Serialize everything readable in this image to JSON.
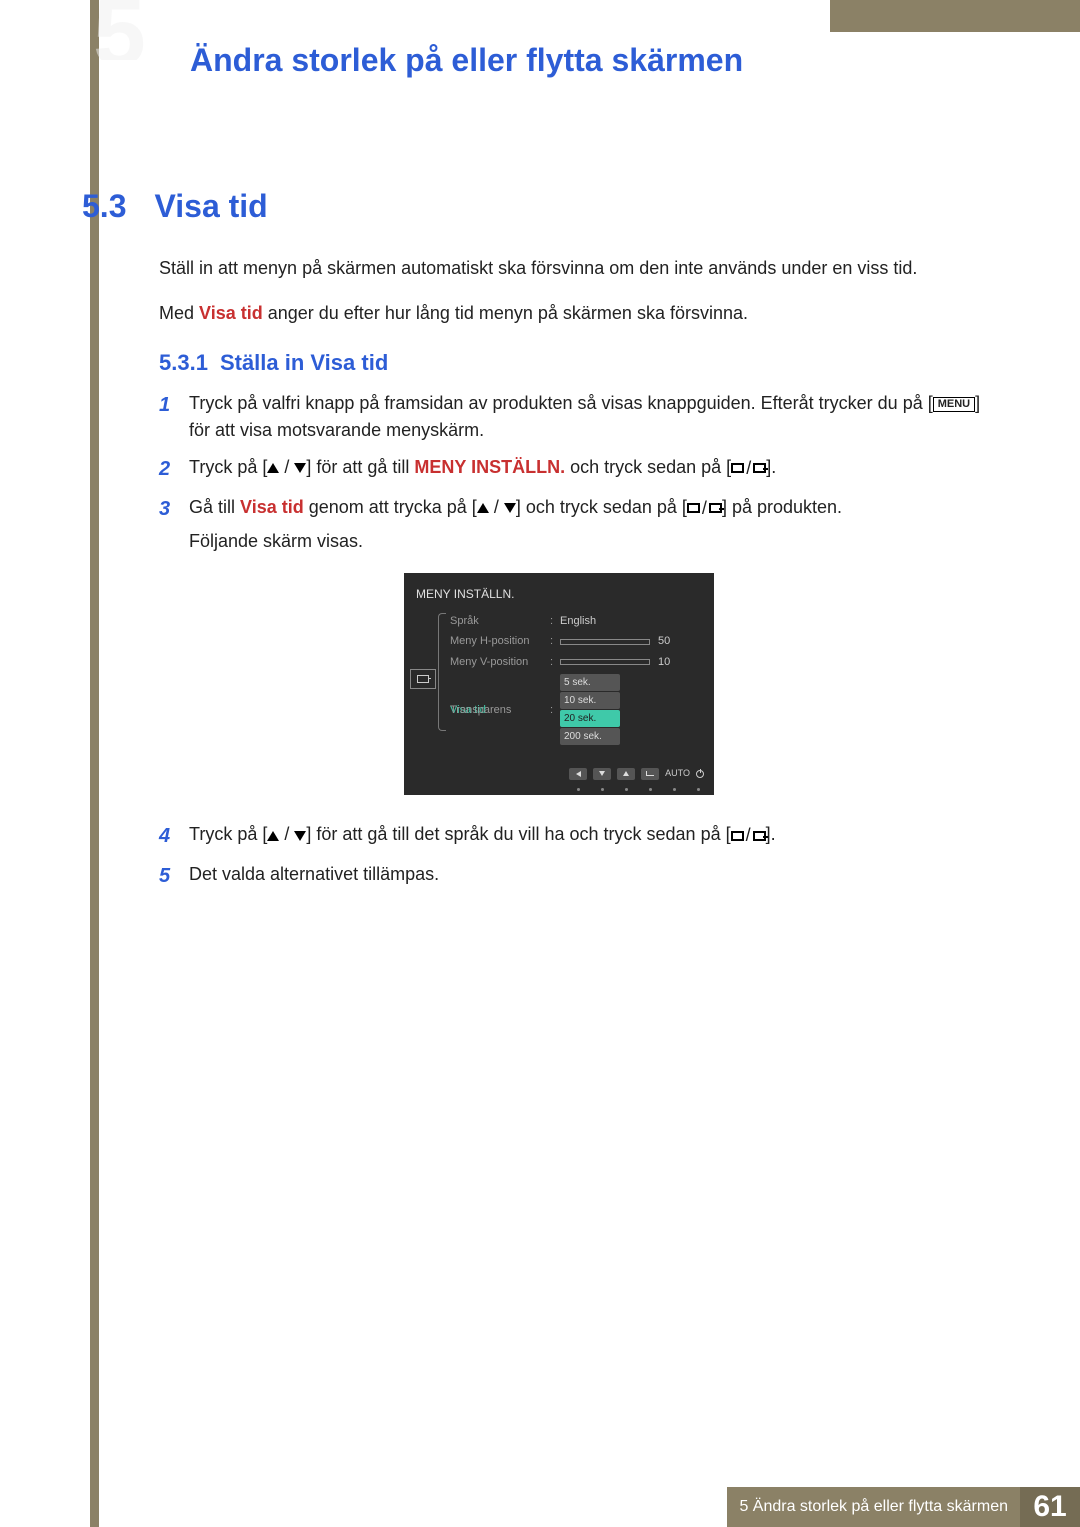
{
  "chapter_bg_number": "5",
  "chapter_title": "Ändra storlek på eller flytta skärmen",
  "section": {
    "number": "5.3",
    "title": "Visa tid"
  },
  "intro": {
    "p1": "Ställ in att menyn på skärmen automatiskt ska försvinna om den inte används under en viss tid.",
    "p2_pre": "Med ",
    "p2_term": "Visa tid",
    "p2_post": " anger du efter hur lång tid menyn på skärmen ska försvinna."
  },
  "subsection": {
    "number": "5.3.1",
    "title": "Ställa in Visa tid"
  },
  "steps": {
    "s1_num": "1",
    "s1_a": "Tryck på valfri knapp på framsidan av produkten så visas knappguiden. Efteråt trycker du på [",
    "s1_menu": "MENU",
    "s1_b": "] för att visa motsvarande menyskärm.",
    "s2_num": "2",
    "s2_a": "Tryck på [",
    "s2_b": "] för att gå till ",
    "s2_term": "MENY INSTÄLLN.",
    "s2_c": " och tryck sedan på [",
    "s2_d": "].",
    "s3_num": "3",
    "s3_a": "Gå till ",
    "s3_term": "Visa tid",
    "s3_b": " genom att trycka på [",
    "s3_c": "] och tryck sedan på [",
    "s3_d": "] på produkten.",
    "s3_e": "Följande skärm visas.",
    "s4_num": "4",
    "s4_a": "Tryck på [",
    "s4_b": "] för att gå till det språk du vill ha och tryck sedan på [",
    "s4_c": "].",
    "s5_num": "5",
    "s5_a": "Det valda alternativet tillämpas."
  },
  "osd": {
    "title": "MENY INSTÄLLN.",
    "rows": {
      "language_label": "Språk",
      "language_value": "English",
      "hpos_label": "Meny H-position",
      "hpos_value": "50",
      "vpos_label": "Meny V-position",
      "vpos_value": "10",
      "visa_label": "Visa tid",
      "trans_label": "Transparens"
    },
    "options": {
      "o1": "5 sek.",
      "o2": "10 sek.",
      "o3": "20 sek.",
      "o4": "200 sek."
    },
    "auto": "AUTO"
  },
  "footer": {
    "text": "5 Ändra storlek på eller flytta skärmen",
    "page": "61"
  }
}
